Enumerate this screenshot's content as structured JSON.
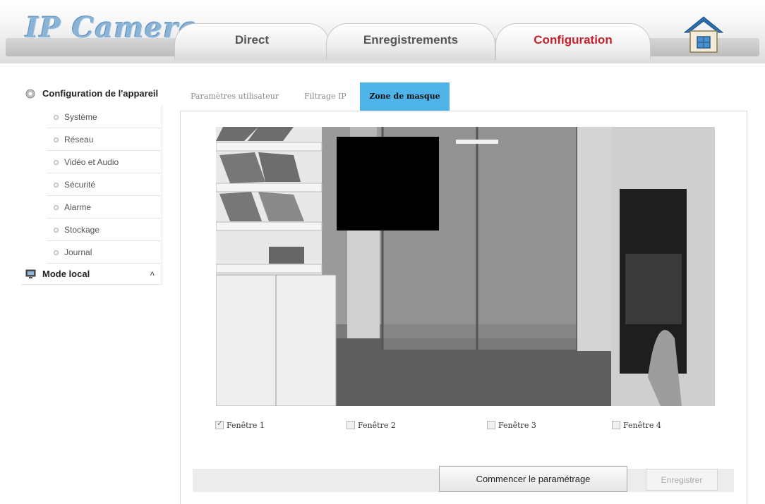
{
  "header": {
    "logo_text": "IP Camera",
    "tabs": [
      {
        "label": "Direct",
        "active": false
      },
      {
        "label": "Enregistrements",
        "active": false
      },
      {
        "label": "Configuration",
        "active": true
      }
    ],
    "active_color": "#c8202a"
  },
  "sidebar": {
    "device_config_label": "Configuration de l'appareil",
    "items": [
      {
        "label": "Système"
      },
      {
        "label": "Réseau"
      },
      {
        "label": "Vidéo et Audio"
      },
      {
        "label": "Sécurité"
      },
      {
        "label": "Alarme"
      },
      {
        "label": "Stockage"
      },
      {
        "label": "Journal"
      }
    ],
    "local_mode_label": "Mode local",
    "local_mode_caret": "˄"
  },
  "subtabs": [
    {
      "label": "Paramètres utilisateur",
      "active": false
    },
    {
      "label": "Filtrage IP",
      "active": false
    },
    {
      "label": "Zone de masque",
      "active": true
    }
  ],
  "accent_color": "#4fb4e8",
  "windows": [
    {
      "label": "Fenêtre 1",
      "checked": true
    },
    {
      "label": "Fenêtre 2",
      "checked": false
    },
    {
      "label": "Fenêtre 3",
      "checked": false
    },
    {
      "label": "Fenêtre 4",
      "checked": false
    }
  ],
  "buttons": {
    "start_label": "Commencer le paramétrage",
    "save_label": "Enregistrer",
    "save_enabled": false
  }
}
